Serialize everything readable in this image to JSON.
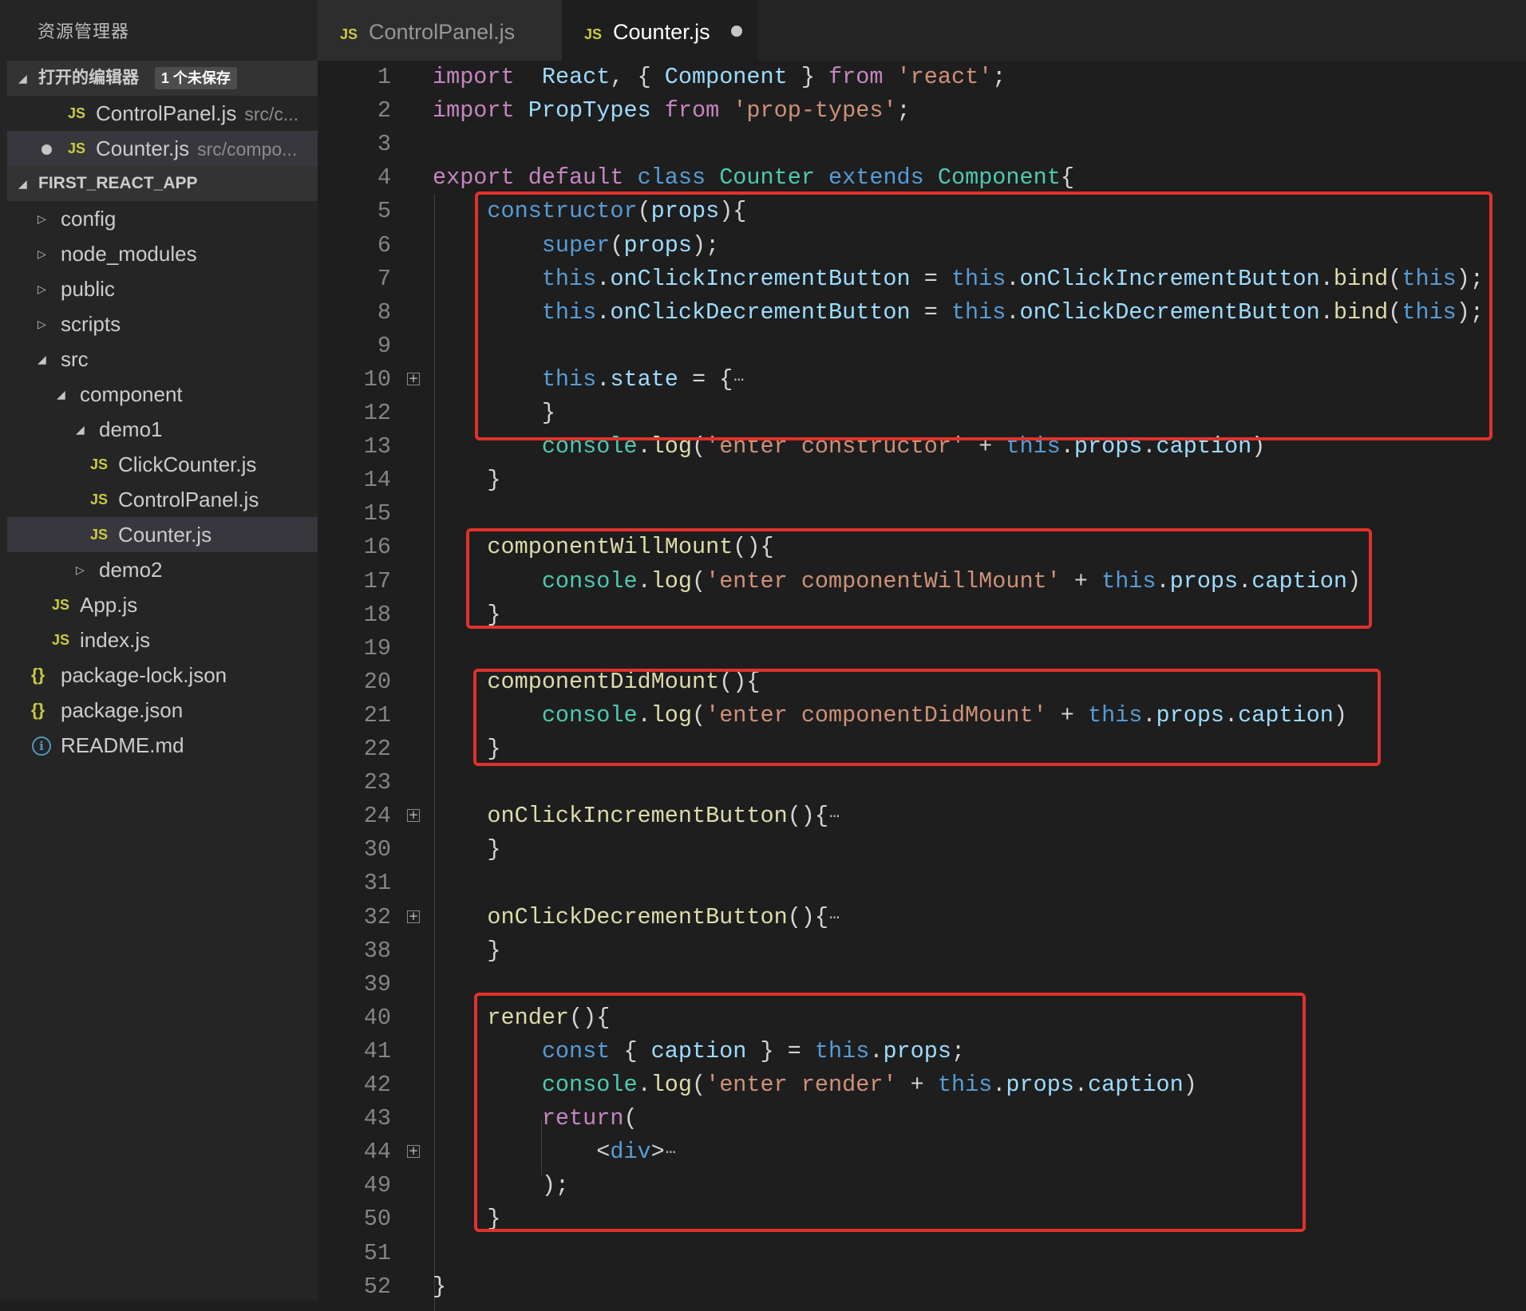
{
  "explorer": {
    "title": "资源管理器",
    "open_editors": {
      "header": "打开的编辑器",
      "badge": "1 个未保存",
      "items": [
        {
          "icon": "JS",
          "name": "ControlPanel.js",
          "path": "src/c..."
        },
        {
          "icon": "JS",
          "name": "Counter.js",
          "path": "src/compo..."
        }
      ]
    },
    "project": {
      "header": "FIRST_REACT_APP",
      "items": [
        {
          "label": "config"
        },
        {
          "label": "node_modules"
        },
        {
          "label": "public"
        },
        {
          "label": "scripts"
        },
        {
          "label": "src"
        },
        {
          "label": "component"
        },
        {
          "label": "demo1"
        },
        {
          "label": "ClickCounter.js",
          "icon": "JS"
        },
        {
          "label": "ControlPanel.js",
          "icon": "JS"
        },
        {
          "label": "Counter.js",
          "icon": "JS"
        },
        {
          "label": "demo2"
        },
        {
          "label": "App.js",
          "icon": "JS"
        },
        {
          "label": "index.js",
          "icon": "JS"
        },
        {
          "label": "package-lock.json",
          "icon": "{}"
        },
        {
          "label": "package.json",
          "icon": "{}"
        },
        {
          "label": "README.md",
          "icon": "i"
        }
      ]
    }
  },
  "tabs": [
    {
      "icon": "JS",
      "label": "ControlPanel.js"
    },
    {
      "icon": "JS",
      "label": "Counter.js"
    }
  ],
  "fold_ellipsis": "···",
  "code_lines": [
    {
      "n": "1",
      "tokens": [
        [
          "kw",
          "import"
        ],
        [
          "",
          "  "
        ],
        [
          "var",
          "React"
        ],
        [
          "",
          ", { "
        ],
        [
          "var",
          "Component"
        ],
        [
          "",
          " } "
        ],
        [
          "kw",
          "from"
        ],
        [
          "",
          " "
        ],
        [
          "str",
          "'react'"
        ],
        [
          "",
          ";"
        ]
      ]
    },
    {
      "n": "2",
      "tokens": [
        [
          "kw",
          "import"
        ],
        [
          "",
          " "
        ],
        [
          "var",
          "PropTypes"
        ],
        [
          "",
          " "
        ],
        [
          "kw",
          "from"
        ],
        [
          "",
          " "
        ],
        [
          "str",
          "'prop-types'"
        ],
        [
          "",
          ";"
        ]
      ]
    },
    {
      "n": "3",
      "tokens": []
    },
    {
      "n": "4",
      "tokens": [
        [
          "kw",
          "export"
        ],
        [
          "",
          " "
        ],
        [
          "kw",
          "default"
        ],
        [
          "",
          " "
        ],
        [
          "kwb",
          "class"
        ],
        [
          "",
          " "
        ],
        [
          "ty",
          "Counter"
        ],
        [
          "",
          " "
        ],
        [
          "kwb",
          "extends"
        ],
        [
          "",
          " "
        ],
        [
          "ty",
          "Component"
        ],
        [
          "",
          "{"
        ]
      ]
    },
    {
      "n": "5",
      "tokens": [
        [
          "",
          "    "
        ],
        [
          "kwb",
          "constructor"
        ],
        [
          "",
          "("
        ],
        [
          "var",
          "props"
        ],
        [
          "",
          "){"
        ]
      ]
    },
    {
      "n": "6",
      "tokens": [
        [
          "",
          "        "
        ],
        [
          "kwb",
          "super"
        ],
        [
          "",
          "("
        ],
        [
          "var",
          "props"
        ],
        [
          "",
          ");"
        ]
      ]
    },
    {
      "n": "7",
      "tokens": [
        [
          "",
          "        "
        ],
        [
          "kwb",
          "this"
        ],
        [
          "",
          "."
        ],
        [
          "var",
          "onClickIncrementButton"
        ],
        [
          "",
          " = "
        ],
        [
          "kwb",
          "this"
        ],
        [
          "",
          "."
        ],
        [
          "var",
          "onClickIncrementButton"
        ],
        [
          "",
          "."
        ],
        [
          "fn",
          "bind"
        ],
        [
          "",
          "("
        ],
        [
          "kwb",
          "this"
        ],
        [
          "",
          ");"
        ]
      ]
    },
    {
      "n": "8",
      "tokens": [
        [
          "",
          "        "
        ],
        [
          "kwb",
          "this"
        ],
        [
          "",
          "."
        ],
        [
          "var",
          "onClickDecrementButton"
        ],
        [
          "",
          " = "
        ],
        [
          "kwb",
          "this"
        ],
        [
          "",
          "."
        ],
        [
          "var",
          "onClickDecrementButton"
        ],
        [
          "",
          "."
        ],
        [
          "fn",
          "bind"
        ],
        [
          "",
          "("
        ],
        [
          "kwb",
          "this"
        ],
        [
          "",
          ");"
        ]
      ]
    },
    {
      "n": "9",
      "tokens": []
    },
    {
      "n": "10",
      "fold": true,
      "tokens": [
        [
          "",
          "        "
        ],
        [
          "kwb",
          "this"
        ],
        [
          "",
          "."
        ],
        [
          "var",
          "state"
        ],
        [
          "",
          " = {"
        ]
      ]
    },
    {
      "n": "12",
      "tokens": [
        [
          "",
          "        }"
        ]
      ]
    },
    {
      "n": "13",
      "tokens": [
        [
          "",
          "        "
        ],
        [
          "ty",
          "console"
        ],
        [
          "",
          "."
        ],
        [
          "fn",
          "log"
        ],
        [
          "",
          "("
        ],
        [
          "str",
          "'enter constructor'"
        ],
        [
          "",
          " + "
        ],
        [
          "kwb",
          "this"
        ],
        [
          "",
          "."
        ],
        [
          "var",
          "props"
        ],
        [
          "",
          "."
        ],
        [
          "var",
          "caption"
        ],
        [
          "",
          ")"
        ]
      ]
    },
    {
      "n": "14",
      "tokens": [
        [
          "",
          "    }"
        ]
      ]
    },
    {
      "n": "15",
      "tokens": []
    },
    {
      "n": "16",
      "tokens": [
        [
          "",
          "    "
        ],
        [
          "fn",
          "componentWillMount"
        ],
        [
          "",
          "(){"
        ]
      ]
    },
    {
      "n": "17",
      "tokens": [
        [
          "",
          "        "
        ],
        [
          "ty",
          "console"
        ],
        [
          "",
          "."
        ],
        [
          "fn",
          "log"
        ],
        [
          "",
          "("
        ],
        [
          "str",
          "'enter componentWillMount'"
        ],
        [
          "",
          " + "
        ],
        [
          "kwb",
          "this"
        ],
        [
          "",
          "."
        ],
        [
          "var",
          "props"
        ],
        [
          "",
          "."
        ],
        [
          "var",
          "caption"
        ],
        [
          "",
          ")"
        ]
      ]
    },
    {
      "n": "18",
      "tokens": [
        [
          "",
          "    }"
        ]
      ]
    },
    {
      "n": "19",
      "tokens": []
    },
    {
      "n": "20",
      "tokens": [
        [
          "",
          "    "
        ],
        [
          "fn",
          "componentDidMount"
        ],
        [
          "",
          "(){"
        ]
      ]
    },
    {
      "n": "21",
      "tokens": [
        [
          "",
          "        "
        ],
        [
          "ty",
          "console"
        ],
        [
          "",
          "."
        ],
        [
          "fn",
          "log"
        ],
        [
          "",
          "("
        ],
        [
          "str",
          "'enter componentDidMount'"
        ],
        [
          "",
          " + "
        ],
        [
          "kwb",
          "this"
        ],
        [
          "",
          "."
        ],
        [
          "var",
          "props"
        ],
        [
          "",
          "."
        ],
        [
          "var",
          "caption"
        ],
        [
          "",
          ")"
        ]
      ]
    },
    {
      "n": "22",
      "tokens": [
        [
          "",
          "    }"
        ]
      ]
    },
    {
      "n": "23",
      "tokens": []
    },
    {
      "n": "24",
      "fold": true,
      "tokens": [
        [
          "",
          "    "
        ],
        [
          "fn",
          "onClickIncrementButton"
        ],
        [
          "",
          "(){"
        ]
      ]
    },
    {
      "n": "30",
      "tokens": [
        [
          "",
          "    }"
        ]
      ]
    },
    {
      "n": "31",
      "tokens": []
    },
    {
      "n": "32",
      "fold": true,
      "tokens": [
        [
          "",
          "    "
        ],
        [
          "fn",
          "onClickDecrementButton"
        ],
        [
          "",
          "(){"
        ]
      ]
    },
    {
      "n": "38",
      "tokens": [
        [
          "",
          "    }"
        ]
      ]
    },
    {
      "n": "39",
      "tokens": []
    },
    {
      "n": "40",
      "tokens": [
        [
          "",
          "    "
        ],
        [
          "fn",
          "render"
        ],
        [
          "",
          "(){"
        ]
      ]
    },
    {
      "n": "41",
      "tokens": [
        [
          "",
          "        "
        ],
        [
          "kwb",
          "const"
        ],
        [
          "",
          " { "
        ],
        [
          "var",
          "caption"
        ],
        [
          "",
          " } = "
        ],
        [
          "kwb",
          "this"
        ],
        [
          "",
          "."
        ],
        [
          "var",
          "props"
        ],
        [
          "",
          ";"
        ]
      ]
    },
    {
      "n": "42",
      "tokens": [
        [
          "",
          "        "
        ],
        [
          "ty",
          "console"
        ],
        [
          "",
          "."
        ],
        [
          "fn",
          "log"
        ],
        [
          "",
          "("
        ],
        [
          "str",
          "'enter render'"
        ],
        [
          "",
          " + "
        ],
        [
          "kwb",
          "this"
        ],
        [
          "",
          "."
        ],
        [
          "var",
          "props"
        ],
        [
          "",
          "."
        ],
        [
          "var",
          "caption"
        ],
        [
          "",
          ")"
        ]
      ]
    },
    {
      "n": "43",
      "tokens": [
        [
          "",
          "        "
        ],
        [
          "kw",
          "return"
        ],
        [
          "",
          "("
        ]
      ]
    },
    {
      "n": "44",
      "fold": true,
      "tokens": [
        [
          "",
          "            <"
        ],
        [
          "kwb",
          "div"
        ],
        [
          "",
          ">"
        ]
      ]
    },
    {
      "n": "49",
      "tokens": [
        [
          "",
          "        );"
        ]
      ]
    },
    {
      "n": "50",
      "tokens": [
        [
          "",
          "    }"
        ]
      ]
    },
    {
      "n": "51",
      "tokens": []
    },
    {
      "n": "52",
      "tokens": [
        [
          "",
          "}"
        ]
      ]
    }
  ]
}
